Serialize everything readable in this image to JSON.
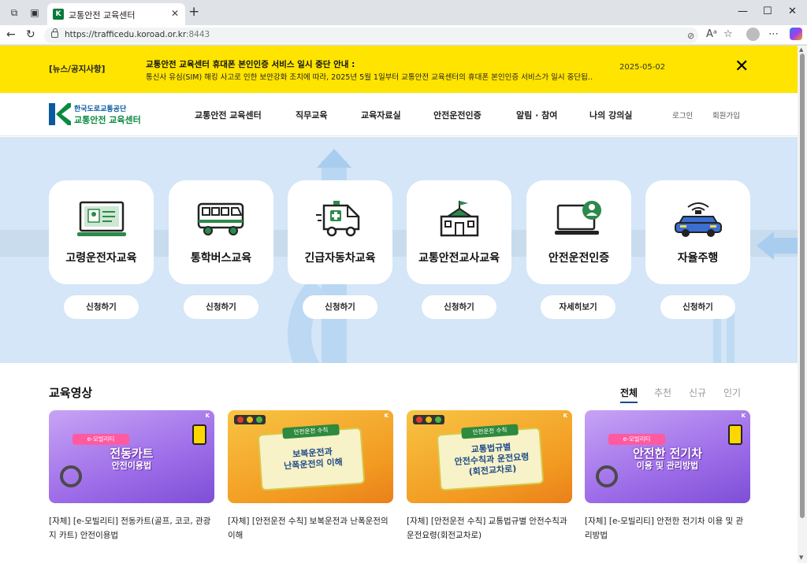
{
  "browser": {
    "tab_title": "교통안전 교육센터",
    "tab_favicon": "K",
    "url_scheme": "https://",
    "url_host": "trafficedu.koroad.or.kr",
    "url_port": ":8443"
  },
  "notice": {
    "tag": "[뉴스/공지사항]",
    "title": "교통안전 교육센터 휴대폰 본인인증 서비스 일시 중단 안내 :",
    "body": "통신사 유심(SIM) 해킹 사고로 인한 보안강화 조치에 따라, 2025년 5월 1일부터 교통안전 교육센터의 휴대폰 본인인증 서비스가 일시 중단됩...",
    "date": "2025-05-02",
    "close_glyph": "✕"
  },
  "header": {
    "logo_line1": "한국도로교통공단",
    "logo_line2": "교통안전 교육센터",
    "logo_mark": "K",
    "nav": [
      "교통안전 교육센터",
      "직무교육",
      "교육자료실",
      "안전운전인증",
      "알림 · 참여",
      "나의 강의실"
    ],
    "login": "로그인",
    "signup": "회원가입"
  },
  "services": [
    {
      "label": "고령운전자교육",
      "button": "신청하기",
      "icon": "monitor-id-icon"
    },
    {
      "label": "통학버스교육",
      "button": "신청하기",
      "icon": "school-bus-icon"
    },
    {
      "label": "긴급자동차교육",
      "button": "신청하기",
      "icon": "ambulance-icon"
    },
    {
      "label": "교통안전교사교육",
      "button": "신청하기",
      "icon": "school-building-icon"
    },
    {
      "label": "안전운전인증",
      "button": "자세히보기",
      "icon": "laptop-user-icon"
    },
    {
      "label": "자율주행",
      "button": "신청하기",
      "icon": "autonomous-car-icon"
    }
  ],
  "videos_section": {
    "title": "교육영상",
    "filters": [
      "전체",
      "추천",
      "신규",
      "인기"
    ],
    "active_filter": "전체"
  },
  "videos": [
    {
      "thumb_main": "전동카트",
      "thumb_sub": "안전이용법",
      "thumb_tag": "e-모빌리티",
      "title": "[자체] [e-모빌리티] 전동카트(골프, 코코, 관광지 카트) 안전이용법",
      "style": "purple"
    },
    {
      "thumb_main": "보복운전과\n난폭운전의 이해",
      "thumb_tag": "안전운전 수칙",
      "title": "[자체] [안전운전 수칙] 보복운전과 난폭운전의 이해",
      "style": "orange"
    },
    {
      "thumb_main": "교통법규별\n안전수칙과 운전요령\n(회전교차로)",
      "thumb_tag": "안전운전 수칙",
      "title": "[자체] [안전운전 수칙] 교통법규별 안전수칙과 운전요령(회전교차로)",
      "style": "orange"
    },
    {
      "thumb_main": "안전한 전기차",
      "thumb_sub": "이용 및 관리방법",
      "thumb_tag": "e-모빌리티",
      "title": "[자체] [e-모빌리티] 안전한 전기차 이용 및 관리방법",
      "style": "purple"
    }
  ],
  "colors": {
    "notice_bg": "#ffe400",
    "hero_bg": "#d4e6f7",
    "brand_green": "#0a8a3e",
    "brand_blue": "#0a5a9e"
  }
}
